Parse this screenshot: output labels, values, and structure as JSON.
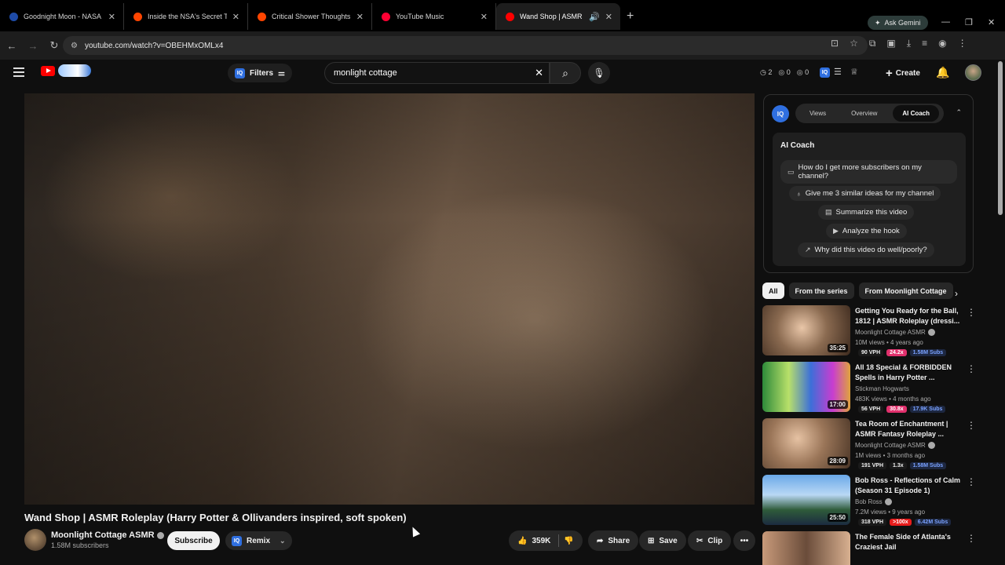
{
  "browser": {
    "tabs": [
      {
        "title": "Goodnight Moon - NASA",
        "favicon_color": "#1e4ba8"
      },
      {
        "title": "Inside the NSA's Secret Tool for",
        "favicon_color": "#ff4500"
      },
      {
        "title": "Critical Shower Thoughts",
        "favicon_color": "#ff4500"
      },
      {
        "title": "YouTube Music",
        "favicon_color": "#ff0033"
      },
      {
        "title": "Wand Shop | ASMR Roleplay",
        "favicon_color": "#ff0000"
      }
    ],
    "ask_gemini": "Ask Gemini",
    "url": "youtube.com/watch?v=OBEHMxOMLx4"
  },
  "header": {
    "filters_label": "Filters",
    "search_value": "monlight cottage",
    "stats": [
      "2",
      "0",
      "0"
    ],
    "create_label": "Create"
  },
  "video": {
    "title": "Wand Shop | ASMR Roleplay (Harry Potter & Ollivanders inspired, soft spoken)",
    "channel": "Moonlight Cottage ASMR",
    "subscribers": "1.58M subscribers",
    "subscribe_label": "Subscribe",
    "remix_label": "Remix",
    "likes": "359K",
    "share_label": "Share",
    "save_label": "Save",
    "clip_label": "Clip"
  },
  "coach": {
    "tabs": [
      "Views",
      "Overview",
      "AI Coach"
    ],
    "heading": "AI Coach",
    "suggestions": [
      "How do I get more subscribers on my channel?",
      "Give me 3 similar ideas for my channel",
      "Summarize this video",
      "Analyze the hook",
      "Why did this video do well/poorly?"
    ]
  },
  "chips": [
    "All",
    "From the series",
    "From Moonlight Cottage"
  ],
  "recommendations": [
    {
      "title": "Getting You Ready for the Ball, 1812 | ASMR Roleplay (dressi...",
      "channel": "Moonlight Cottage ASMR",
      "meta": "10M views • 4 years ago",
      "duration": "35:25",
      "vph": "90 VPH",
      "mult": "24.2x",
      "subs": "1.58M Subs"
    },
    {
      "title": "All 18 Special & FORBIDDEN Spells in Harry Potter ...",
      "channel": "Stickman Hogwarts",
      "meta": "483K views • 4 months ago",
      "duration": "17:00",
      "vph": "56 VPH",
      "mult": "30.8x",
      "subs": "17.9K Subs"
    },
    {
      "title": "Tea Room of Enchantment | ASMR Fantasy Roleplay ...",
      "channel": "Moonlight Cottage ASMR",
      "meta": "1M views • 3 months ago",
      "duration": "28:09",
      "vph": "191 VPH",
      "mult": "1.3x",
      "subs": "1.58M Subs"
    },
    {
      "title": "Bob Ross - Reflections of Calm (Season 31 Episode 1)",
      "channel": "Bob Ross",
      "meta": "7.2M views • 9 years ago",
      "duration": "25:50",
      "vph": "318 VPH",
      "mult": ">100x",
      "subs": "6.42M Subs"
    },
    {
      "title": "The Female Side of Atlanta's Craziest Jail",
      "channel": "",
      "meta": "",
      "duration": "",
      "vph": "",
      "mult": "",
      "subs": ""
    }
  ]
}
